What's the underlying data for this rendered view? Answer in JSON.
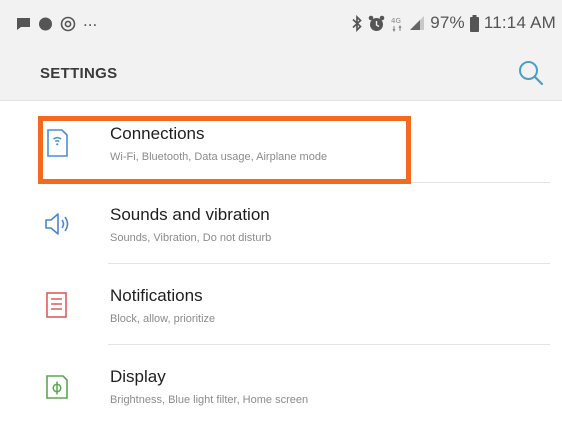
{
  "status_bar": {
    "overflow": "...",
    "battery": "97%",
    "time": "11:14 AM",
    "icons": [
      "message-icon",
      "messenger-icon",
      "at-sign-icon",
      "bluetooth-icon",
      "alarm-icon",
      "network-4g-icon",
      "signal-icon",
      "battery-icon"
    ]
  },
  "header": {
    "title": "SETTINGS",
    "search_icon": "search-icon"
  },
  "items": [
    {
      "title": "Connections",
      "subtitle": "Wi-Fi, Bluetooth, Data usage, Airplane mode",
      "icon": "connections-icon",
      "icon_color": "#4a8fd6",
      "highlighted": true
    },
    {
      "title": "Sounds and vibration",
      "subtitle": "Sounds, Vibration, Do not disturb",
      "icon": "speaker-icon",
      "icon_color": "#4a86d0"
    },
    {
      "title": "Notifications",
      "subtitle": "Block, allow, prioritize",
      "icon": "notifications-icon",
      "icon_color": "#e25b5b"
    },
    {
      "title": "Display",
      "subtitle": "Brightness, Blue light filter, Home screen",
      "icon": "display-icon",
      "icon_color": "#5aa84f"
    }
  ],
  "colors": {
    "highlight": "#f26b1c",
    "search": "#4a9fc8"
  }
}
